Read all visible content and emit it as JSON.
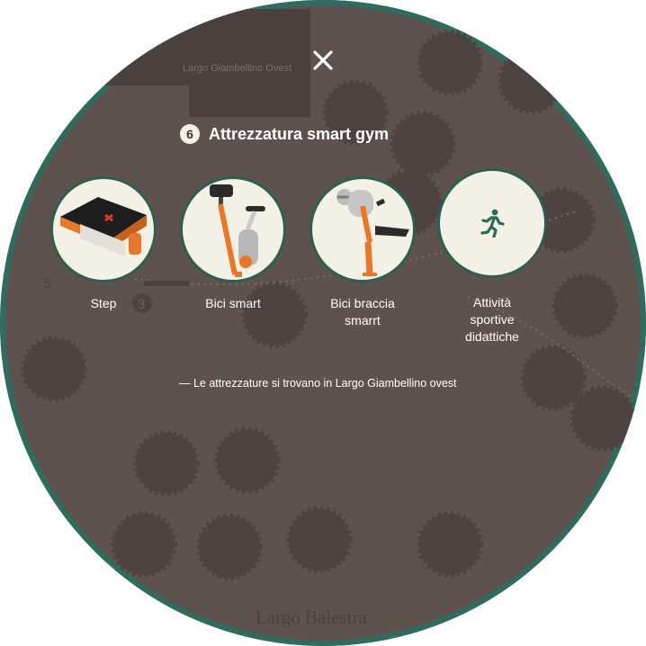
{
  "map": {
    "street_top": "Largo Giambellino Ovest",
    "street_bottom": "Largo Balestra",
    "markers": [
      "5",
      "3"
    ]
  },
  "close_icon": "close-icon",
  "section": {
    "number": "6",
    "title": "Attrezzatura smart gym"
  },
  "items": [
    {
      "label": "Step",
      "icon": "step-platform-image"
    },
    {
      "label": "Bici smart",
      "icon": "exercise-bike-image"
    },
    {
      "label": "Bici braccia smarrt",
      "icon": "arm-bike-image"
    },
    {
      "label": "Attività sportive didattiche",
      "icon": "running-person-icon"
    }
  ],
  "note": "— Le attrezzature si trovano in Largo Giambellino ovest",
  "colors": {
    "background": "#5e524e",
    "ring": "#2f6b5e",
    "accent_orange": "#f07d1a",
    "disk": "#f3f0e5",
    "icon_green": "#2d6a5a"
  }
}
